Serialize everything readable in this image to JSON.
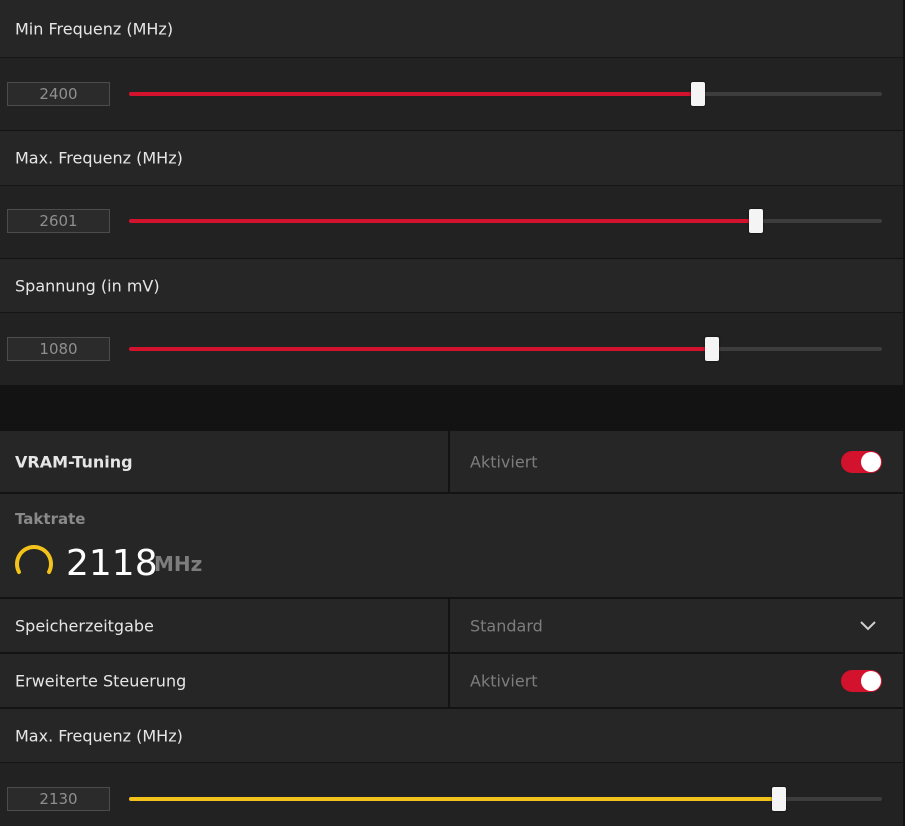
{
  "gpu": {
    "min_freq": {
      "label": "Min Frequenz (MHz)",
      "value": "2400",
      "fill_percent": 75.5
    },
    "max_freq": {
      "label": "Max. Frequenz (MHz)",
      "value": "2601",
      "fill_percent": 83.3
    },
    "voltage": {
      "label": "Spannung (in mV)",
      "value": "1080",
      "fill_percent": 77.4
    }
  },
  "vram": {
    "tuning_label": "VRAM-Tuning",
    "tuning_status": "Aktiviert",
    "tuning_enabled": true,
    "clock_heading": "Taktrate",
    "clock_value": "2118",
    "clock_unit": "MHz",
    "timing_label": "Speicherzeitgabe",
    "timing_value": "Standard",
    "advanced_label": "Erweiterte Steuerung",
    "advanced_status": "Aktiviert",
    "advanced_enabled": true,
    "max_freq": {
      "label": "Max. Frequenz (MHz)",
      "value": "2130",
      "fill_percent": 86.3
    }
  },
  "colors": {
    "accent_red": "#d3122d",
    "accent_yellow": "#f3c21b",
    "panel": "#262626",
    "background": "#131313"
  },
  "icons": [
    "clock-gauge-icon",
    "chevron-down-icon"
  ]
}
